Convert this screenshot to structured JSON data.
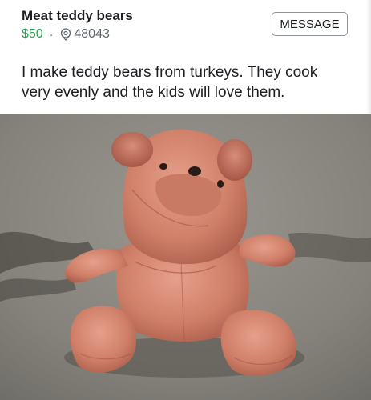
{
  "listing": {
    "title": "Meat teddy bears",
    "price": "$50",
    "separator": "·",
    "location_zip": "48043",
    "description": "I make teddy bears from turkeys. They cook very evenly and the kids will love them.",
    "message_label": "MESSAGE"
  },
  "colors": {
    "price_green": "#2e9e53",
    "text_dark": "#1c1e21",
    "text_gray": "#606770"
  },
  "icons": {
    "location": "map-pin-icon"
  }
}
